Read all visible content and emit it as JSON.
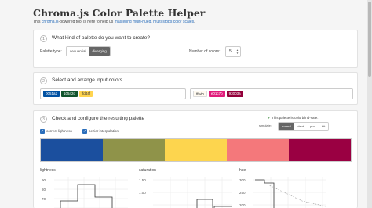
{
  "title": "Chroma.js Color Palette Helper",
  "intro": {
    "pre": "This ",
    "link1": "chroma.js",
    "mid": "-powered tool is here to help us ",
    "link2": "mastering multi-hued, multi-stops color scales",
    "post": "."
  },
  "step1": {
    "num": "1",
    "title": "What kind of palette do you want to create?",
    "palette_type_label": "Palette type:",
    "options": [
      "sequential",
      "diverging"
    ],
    "selected": "diverging",
    "num_colors_label": "Number of colors:",
    "num_colors": "5"
  },
  "step2": {
    "num": "2",
    "title": "Select and arrange input colors",
    "left_colors": [
      {
        "hex": "0051a2",
        "bg": "#0051a2",
        "fg": "#ffffff"
      },
      {
        "hex": "10542c",
        "bg": "#10542c",
        "fg": "#ffffff"
      },
      {
        "hex": "ffd44f",
        "bg": "#ffd44f",
        "fg": "#333333"
      }
    ],
    "right_colors": [
      {
        "hex": "fffaf0",
        "bg": "#fffaf0",
        "fg": "#333333"
      },
      {
        "hex": "e01c7b",
        "bg": "#e01c7b",
        "fg": "#ffffff"
      },
      {
        "hex": "93003a",
        "bg": "#93003a",
        "fg": "#ffffff"
      }
    ]
  },
  "step3": {
    "num": "3",
    "title": "Check and configure the resulting palette",
    "correct_lightness": "correct lightness",
    "bezier": "bezier interpolation",
    "safe_msg": "This palette is colorblind-safe.",
    "simulate_label": "simulate:",
    "simulate_options": [
      "normal",
      "deut",
      "prot",
      "trit"
    ],
    "simulate_selected": "normal",
    "palette": [
      "#1b4f9e",
      "#8f9349",
      "#fdd54e",
      "#f4787b",
      "#9a0042"
    ]
  },
  "charts": {
    "lightness": {
      "title": "lightness",
      "ticks": [
        "90",
        "80",
        "70"
      ]
    },
    "saturation": {
      "title": "saturation",
      "ticks": [
        "1.50",
        "1.00"
      ]
    },
    "hue": {
      "title": "hue",
      "ticks": [
        "300",
        "250",
        "200"
      ]
    }
  },
  "colors": {
    "link": "#2a6ebb",
    "active_button": "#666666",
    "checkbox": "#2a6ebb"
  }
}
